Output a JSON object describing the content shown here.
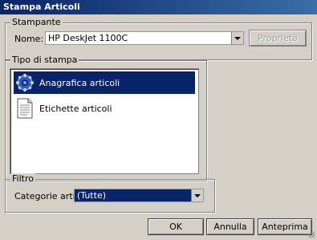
{
  "window": {
    "title": "Stampa Articoli"
  },
  "printer_group": {
    "legend": "Stampante",
    "name_label": "Nome:",
    "selected_printer": "HP DeskJet 1100C",
    "properties_label": "Proprietà"
  },
  "print_type_group": {
    "legend": "Tipo di stampa",
    "items": [
      {
        "label": "Anagrafica articoli",
        "icon": "gear-icon",
        "selected": true
      },
      {
        "label": "Etichette articoli",
        "icon": "document-icon",
        "selected": false
      }
    ]
  },
  "filter_group": {
    "legend": "Filtro",
    "category_label": "Categorie articoli:",
    "category_value": "(Tutte)"
  },
  "buttons": {
    "ok": "OK",
    "cancel": "Annulla",
    "preview": "Anteprima"
  }
}
